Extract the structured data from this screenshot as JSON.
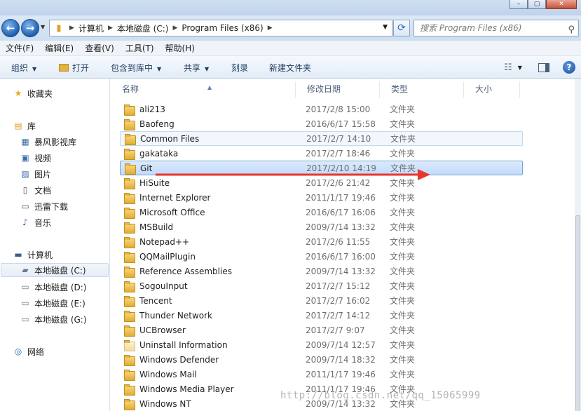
{
  "address": {
    "crumbs": [
      "计算机",
      "本地磁盘 (C:)",
      "Program Files (x86)"
    ]
  },
  "search": {
    "placeholder": "搜索 Program Files (x86)"
  },
  "menu": [
    "文件(F)",
    "编辑(E)",
    "查看(V)",
    "工具(T)",
    "帮助(H)"
  ],
  "toolbar": {
    "organize": "组织",
    "open": "打开",
    "include_library": "包含到库中",
    "share": "共享",
    "burn": "刻录",
    "new_folder": "新建文件夹"
  },
  "nav": {
    "favorites": "收藏夹",
    "libraries": "库",
    "lib_items": [
      "暴风影视库",
      "视频",
      "图片",
      "文档",
      "迅雷下载",
      "音乐"
    ],
    "computer": "计算机",
    "drives": [
      "本地磁盘 (C:)",
      "本地磁盘 (D:)",
      "本地磁盘 (E:)",
      "本地磁盘 (G:)"
    ],
    "network": "网络"
  },
  "columns": {
    "name": "名称",
    "date": "修改日期",
    "type": "类型",
    "size": "大小"
  },
  "files": [
    {
      "name": "ali213",
      "date": "2017/2/8 15:00",
      "type": "文件夹"
    },
    {
      "name": "Baofeng",
      "date": "2016/6/17 15:58",
      "type": "文件夹"
    },
    {
      "name": "Common Files",
      "date": "2017/2/7 14:10",
      "type": "文件夹"
    },
    {
      "name": "gakataka",
      "date": "2017/2/7 18:46",
      "type": "文件夹"
    },
    {
      "name": "Git",
      "date": "2017/2/10 14:19",
      "type": "文件夹"
    },
    {
      "name": "HiSuite",
      "date": "2017/2/6 21:42",
      "type": "文件夹"
    },
    {
      "name": "Internet Explorer",
      "date": "2011/1/17 19:46",
      "type": "文件夹"
    },
    {
      "name": "Microsoft Office",
      "date": "2016/6/17 16:06",
      "type": "文件夹"
    },
    {
      "name": "MSBuild",
      "date": "2009/7/14 13:32",
      "type": "文件夹"
    },
    {
      "name": "Notepad++",
      "date": "2017/2/6 11:55",
      "type": "文件夹"
    },
    {
      "name": "QQMailPlugin",
      "date": "2016/6/17 16:00",
      "type": "文件夹"
    },
    {
      "name": "Reference Assemblies",
      "date": "2009/7/14 13:32",
      "type": "文件夹"
    },
    {
      "name": "SogouInput",
      "date": "2017/2/7 15:12",
      "type": "文件夹"
    },
    {
      "name": "Tencent",
      "date": "2017/2/7 16:02",
      "type": "文件夹"
    },
    {
      "name": "Thunder Network",
      "date": "2017/2/7 14:12",
      "type": "文件夹"
    },
    {
      "name": "UCBrowser",
      "date": "2017/2/7 9:07",
      "type": "文件夹"
    },
    {
      "name": "Uninstall Information",
      "date": "2009/7/14 12:57",
      "type": "文件夹"
    },
    {
      "name": "Windows Defender",
      "date": "2009/7/14 18:32",
      "type": "文件夹"
    },
    {
      "name": "Windows Mail",
      "date": "2011/1/17 19:46",
      "type": "文件夹"
    },
    {
      "name": "Windows Media Player",
      "date": "2011/1/17 19:46",
      "type": "文件夹"
    },
    {
      "name": "Windows NT",
      "date": "2009/7/14 13:32",
      "type": "文件夹"
    }
  ],
  "watermark": "http://blog.csdn.net/qq_15065999",
  "colors": {
    "selection": "#c1dbfc",
    "annotation_arrow": "#e8372c"
  }
}
